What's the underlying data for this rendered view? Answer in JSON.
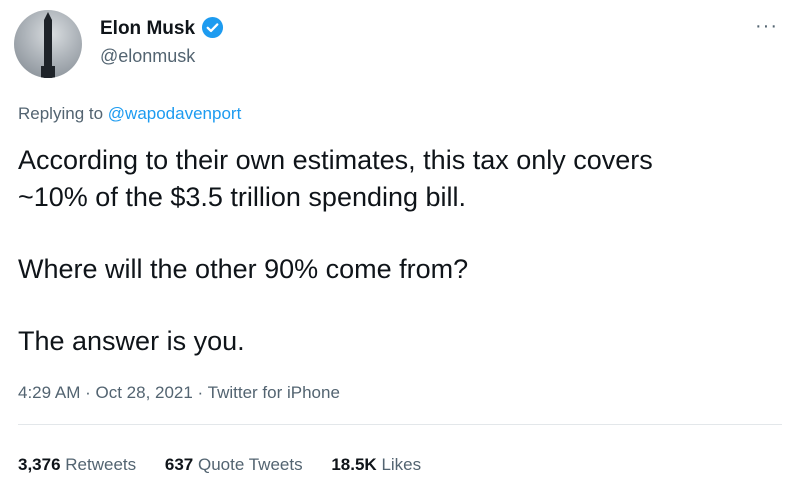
{
  "author": {
    "name": "Elon Musk",
    "handle": "@elonmusk",
    "verified_color": "#1d9bf0"
  },
  "menu": {
    "more_label": "···"
  },
  "reply": {
    "prefix": "Replying to ",
    "mention": "@wapodavenport"
  },
  "text": {
    "line1": "According to their own estimates, this tax only covers",
    "line2": "~10% of the $3.5 trillion spending bill.",
    "line3": "Where will the other 90% come from?",
    "line4": "The answer is you."
  },
  "meta": {
    "time": "4:29 AM",
    "sep1": " · ",
    "date": "Oct 28, 2021",
    "sep2": " · ",
    "source": "Twitter for iPhone"
  },
  "stats": {
    "retweets_count": "3,376",
    "retweets_label": "Retweets",
    "quotes_count": "637",
    "quotes_label": "Quote Tweets",
    "likes_count": "18.5K",
    "likes_label": "Likes"
  }
}
